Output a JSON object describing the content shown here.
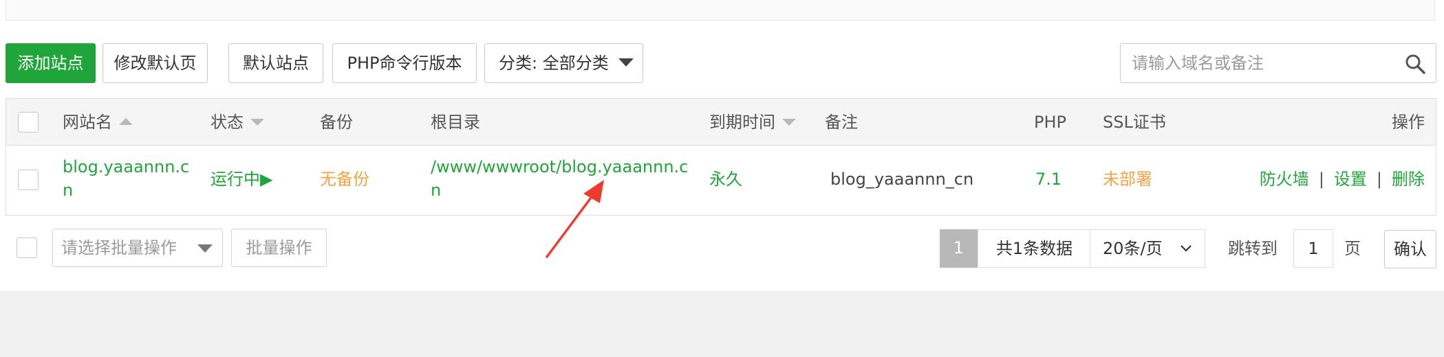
{
  "toolbar": {
    "add_site": "添加站点",
    "edit_default_page": "修改默认页",
    "default_site": "默认站点",
    "php_cli_version": "PHP命令行版本",
    "category": "分类: 全部分类",
    "search_placeholder": "请输入域名或备注"
  },
  "table": {
    "columns": [
      "网站名",
      "状态",
      "备份",
      "根目录",
      "到期时间",
      "备注",
      "PHP",
      "SSL证书",
      "操作"
    ],
    "rows": [
      {
        "site_name": "blog.yaaannn.cn",
        "status": "运行中▶",
        "backup": "无备份",
        "root": "/www/wwwroot/blog.yaaannn.cn",
        "expire": "永久",
        "remark": "blog_yaaannn_cn",
        "php": "7.1",
        "ssl": "未部署",
        "actions": [
          "防火墙",
          "设置",
          "删除"
        ]
      }
    ]
  },
  "footer": {
    "batch_placeholder": "请选择批量操作",
    "batch_button": "批量操作",
    "current_page": "1",
    "total": "共1条数据",
    "page_size": "20条/页",
    "jump_label": "跳转到",
    "jump_value": "1",
    "page_unit": "页",
    "confirm": "确认"
  },
  "colors": {
    "primary": "#20a53a",
    "warning": "#f0a444",
    "annotation_arrow": "#ee3b2f"
  },
  "icons": {
    "search": "search-icon",
    "sort": "sort-caret-icon",
    "dropdown": "caret-down-icon"
  }
}
